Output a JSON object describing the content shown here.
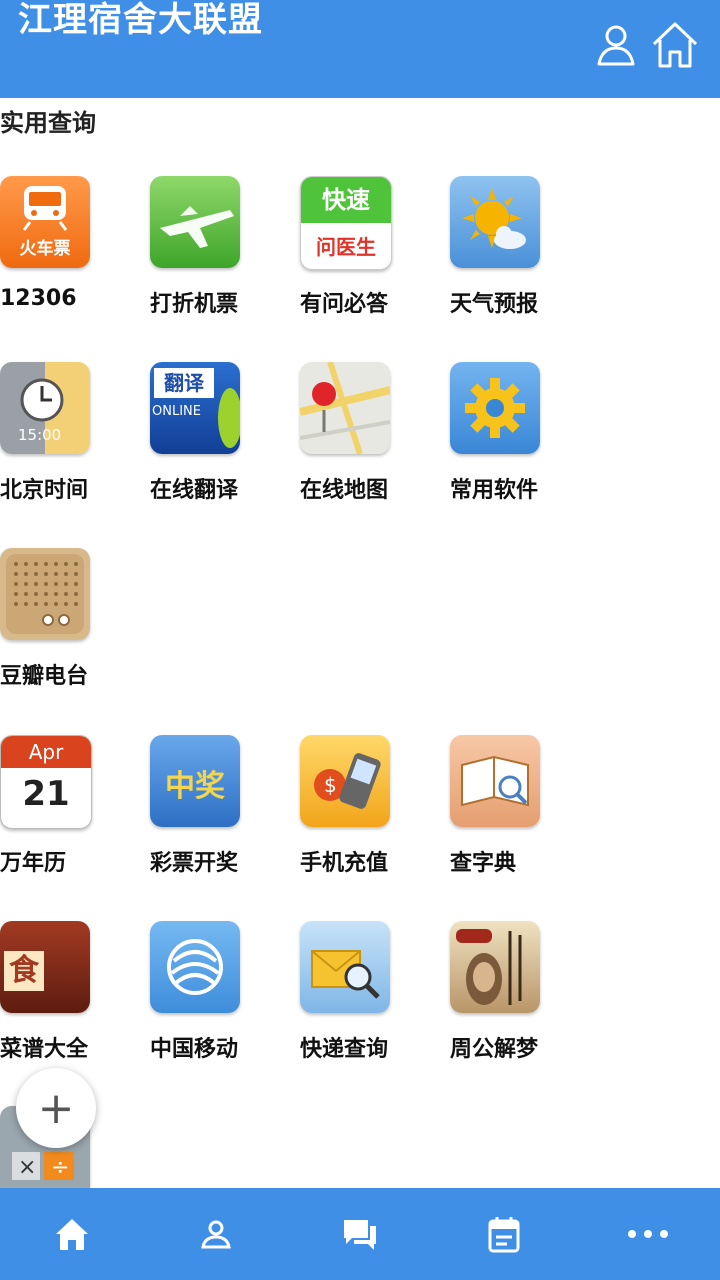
{
  "header": {
    "title": "江理宿舍大联盟",
    "icons": [
      "user-icon",
      "home-icon"
    ],
    "color": "#3f8fe6"
  },
  "section": {
    "title": "实用查询"
  },
  "apps": [
    {
      "label": "12306",
      "icon": "train-ticket-icon",
      "tile_text": "火车票"
    },
    {
      "label": "打折机票",
      "icon": "airplane-icon"
    },
    {
      "label": "有问必答",
      "icon": "doctor-qa-icon",
      "tile_text_top": "快速",
      "tile_text_bottom": "问医生"
    },
    {
      "label": "天气预报",
      "icon": "weather-icon"
    },
    {
      "label": "北京时间",
      "icon": "clock-icon",
      "tile_text": "15:00"
    },
    {
      "label": "在线翻译",
      "icon": "translate-icon",
      "tile_text_top": "翻译",
      "tile_text_bottom": "ONLINE"
    },
    {
      "label": "在线地图",
      "icon": "map-icon"
    },
    {
      "label": "常用软件",
      "icon": "gear-icon"
    },
    {
      "label": "豆瓣电台",
      "icon": "radio-icon"
    },
    {
      "label": "万年历",
      "icon": "calendar-icon",
      "tile_text_top": "Apr",
      "tile_text_bottom": "21"
    },
    {
      "label": "彩票开奖",
      "icon": "lottery-icon",
      "tile_text": "中奖"
    },
    {
      "label": "手机充值",
      "icon": "phone-recharge-icon"
    },
    {
      "label": "查字典",
      "icon": "dictionary-icon"
    },
    {
      "label": "菜谱大全",
      "icon": "recipe-icon",
      "tile_text": "食"
    },
    {
      "label": "中国移动",
      "icon": "china-mobile-icon"
    },
    {
      "label": "快递查询",
      "icon": "express-icon"
    },
    {
      "label": "周公解梦",
      "icon": "dream-icon"
    },
    {
      "label": "",
      "icon": "calculator-icon"
    }
  ],
  "fab": {
    "label": "+"
  },
  "bottom_nav": {
    "items": [
      {
        "icon": "home-icon"
      },
      {
        "icon": "profile-icon"
      },
      {
        "icon": "chat-icon"
      },
      {
        "icon": "calendar-icon"
      },
      {
        "icon": "more-icon"
      }
    ]
  }
}
